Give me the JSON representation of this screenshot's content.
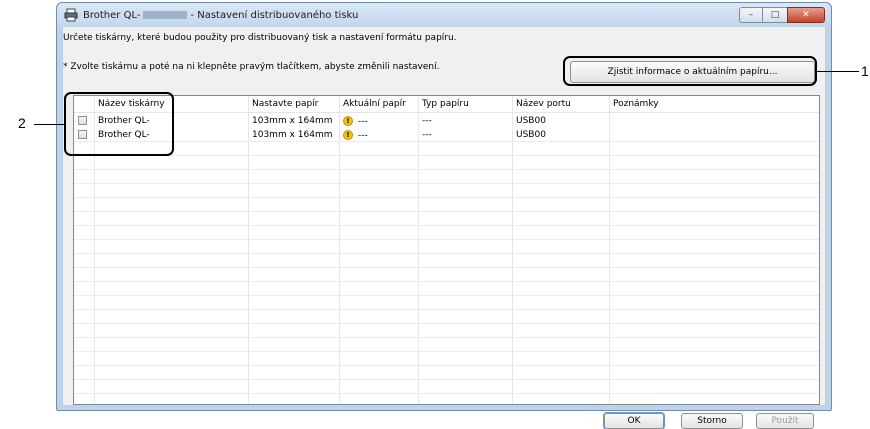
{
  "window": {
    "title_prefix": "Brother QL-",
    "title_suffix": "- Nastavení distribuovaného tisku",
    "controls": {
      "minimize": "–",
      "maximize": "□",
      "close": "✕"
    }
  },
  "instruction": "Určete tiskárny, které budou použity pro distribuovaný tisk a nastavení formátu papíru.",
  "note": "* Zvolte tiskárnu a poté na ni klepněte pravým tlačítkem, abyste změnili nastavení.",
  "buttons": {
    "get_info": "Zjistit informace o aktuálním papíru...",
    "ok": "OK",
    "cancel": "Storno",
    "apply": "Použít"
  },
  "table": {
    "columns": [
      "Název tiskárny",
      "Nastavte papír",
      "Aktuální papír",
      "Typ papíru",
      "Název portu",
      "Poznámky"
    ],
    "rows": [
      {
        "name": "Brother QL-",
        "paper": "103mm x 164mm",
        "current": "---",
        "type": "---",
        "port": "USB00",
        "notes": ""
      },
      {
        "name": "Brother QL-",
        "paper": "103mm x 164mm",
        "current": "---",
        "type": "---",
        "port": "USB00",
        "notes": ""
      }
    ]
  },
  "callouts": {
    "one": "1",
    "two": "2"
  },
  "icons": {
    "warning": "warning-icon",
    "printer": "printer-icon"
  }
}
